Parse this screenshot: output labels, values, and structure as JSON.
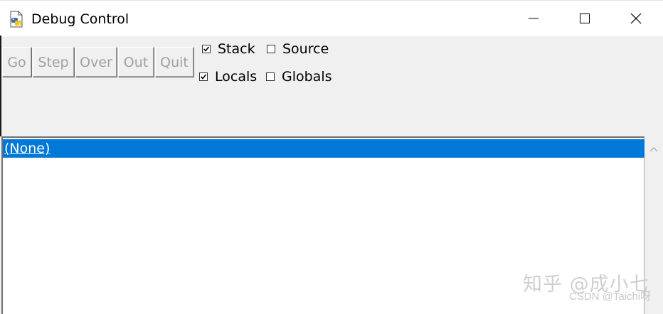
{
  "window": {
    "title": "Debug Control",
    "icon": "python-idle-icon",
    "controls": [
      "minimize-icon",
      "maximize-icon",
      "close-icon"
    ]
  },
  "toolbar": {
    "buttons": [
      {
        "label": "Go",
        "enabled": false
      },
      {
        "label": "Step",
        "enabled": false
      },
      {
        "label": "Over",
        "enabled": false
      },
      {
        "label": "Out",
        "enabled": false
      },
      {
        "label": "Quit",
        "enabled": false
      }
    ]
  },
  "options": {
    "stack": {
      "label": "Stack",
      "checked": true
    },
    "source": {
      "label": "Source",
      "checked": false
    },
    "locals": {
      "label": "Locals",
      "checked": true
    },
    "globals": {
      "label": "Globals",
      "checked": false
    }
  },
  "stack_list": {
    "items": [
      {
        "text": "(None)",
        "selected": true
      }
    ]
  },
  "watermark": {
    "main": "知乎 @成小七",
    "sub": "CSDN @Taichi呀"
  },
  "colors": {
    "selection": "#0078d7",
    "disabled_text": "#a0a0a0",
    "background": "#f0f0f0"
  }
}
